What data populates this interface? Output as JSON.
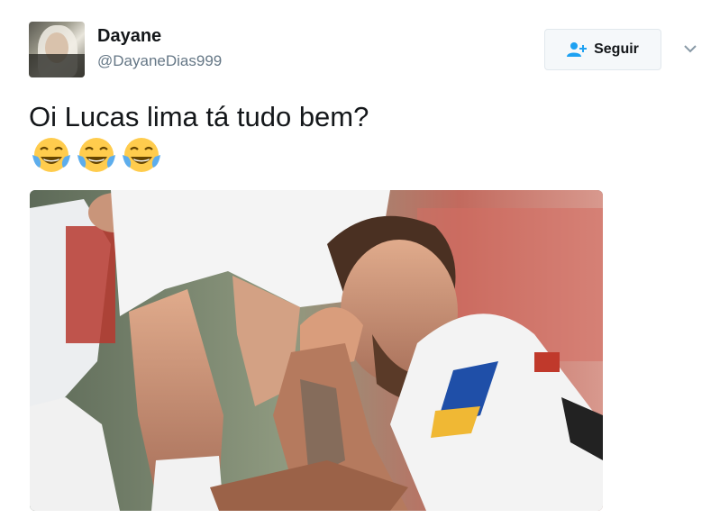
{
  "user": {
    "name": "Dayane",
    "handle": "@DayaneDias999",
    "avatar_icon": "avatar-photo"
  },
  "follow": {
    "label": "Seguir",
    "icon": "user-plus-icon"
  },
  "menu": {
    "icon": "chevron-down-icon"
  },
  "tweet": {
    "text": "Oi Lucas lima tá tudo bem?",
    "emojis": [
      "😂",
      "😂",
      "😂"
    ]
  },
  "colors": {
    "text": "#14171a",
    "secondary": "#657786",
    "accent": "#1da1f2",
    "button_bg": "#f5f8fa",
    "button_border": "#e1e8ed"
  }
}
